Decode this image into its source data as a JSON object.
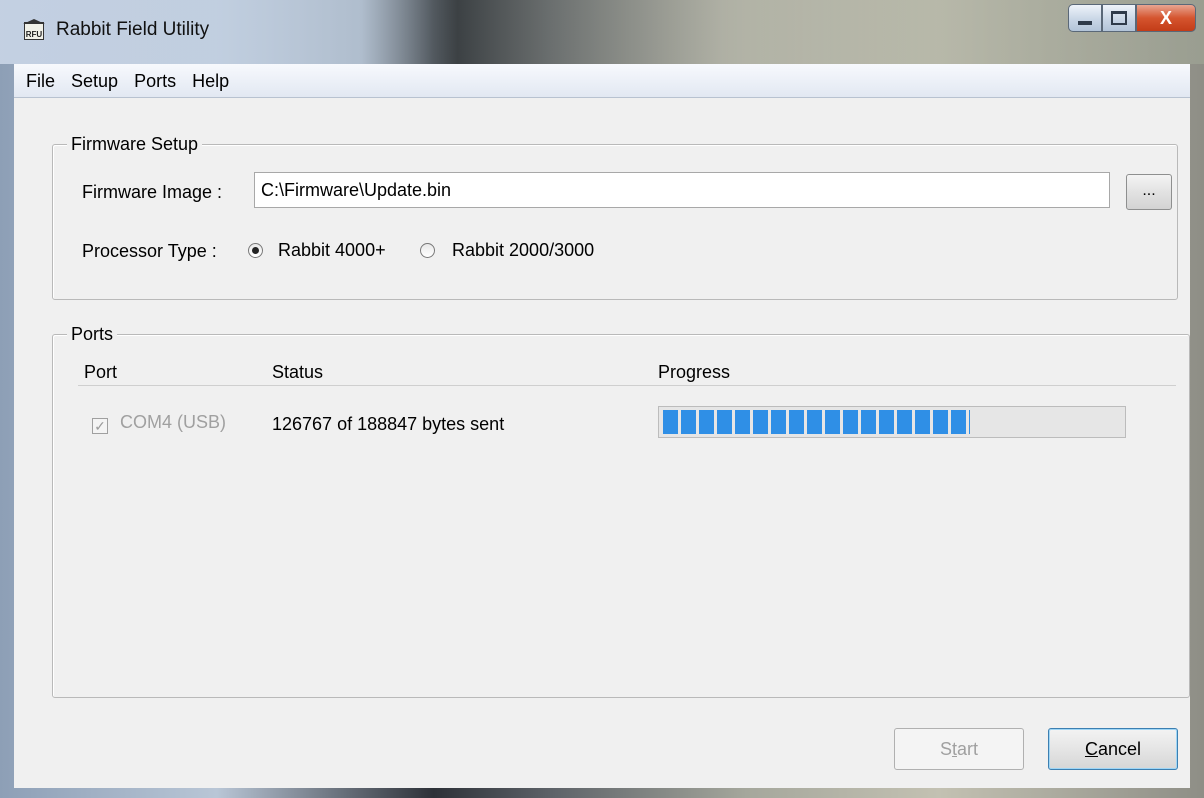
{
  "window": {
    "title": "Rabbit Field Utility",
    "app_icon_text": "RFU",
    "controls": {
      "minimize": "minimize",
      "maximize": "maximize",
      "close": "X"
    }
  },
  "menu": {
    "items": [
      "File",
      "Setup",
      "Ports",
      "Help"
    ]
  },
  "firmware_setup": {
    "legend": "Firmware Setup",
    "image_label": "Firmware Image :",
    "image_value": "C:\\Firmware\\Update.bin",
    "browse_label": "...",
    "processor_label": "Processor Type :",
    "processor_options": [
      {
        "label": "Rabbit 4000+",
        "selected": true
      },
      {
        "label": "Rabbit 2000/3000",
        "selected": false
      }
    ]
  },
  "ports": {
    "legend": "Ports",
    "columns": [
      "Port",
      "Status",
      "Progress"
    ],
    "rows": [
      {
        "port": "COM4 (USB)",
        "checked": true,
        "enabled": false,
        "status": "126767 of 188847 bytes sent",
        "progress": 0.6713
      }
    ]
  },
  "buttons": {
    "start_prefix": "S",
    "start_accel": "t",
    "start_suffix": "art",
    "start_enabled": false,
    "cancel_accel": "C",
    "cancel_suffix": "ancel"
  },
  "colors": {
    "progress": "#2f8fe6",
    "close_button": "#d5552f"
  }
}
